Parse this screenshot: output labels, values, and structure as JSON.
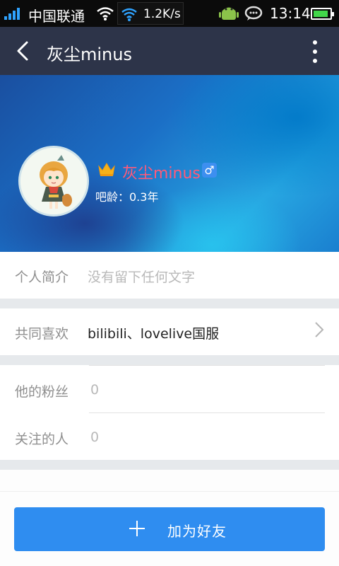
{
  "status_bar": {
    "carrier": "中国联通",
    "net_speed": "1.2K/s",
    "time": "13:14"
  },
  "header": {
    "title": "灰尘minus"
  },
  "profile": {
    "username": "灰尘minus",
    "gender_symbol": "♂",
    "bar_age": "吧龄：0.3年"
  },
  "intro": {
    "label": "个人简介",
    "value": "没有留下任何文字"
  },
  "common_likes": {
    "label": "共同喜欢",
    "value": "bilibili、lovelive国服"
  },
  "fans": {
    "label": "他的粉丝",
    "value": "0"
  },
  "following": {
    "label": "关注的人",
    "value": "0"
  },
  "add_friend": {
    "label": "加为好友"
  },
  "colors": {
    "header_bg": "#2d3449",
    "username": "#ff5a7a",
    "button": "#2f8df0",
    "gender_badge": "#3d8ff0"
  }
}
